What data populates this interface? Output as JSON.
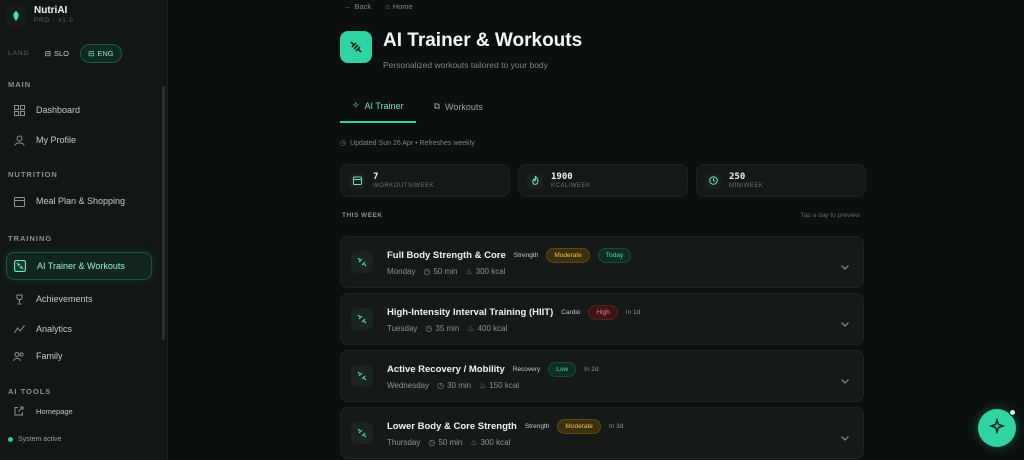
{
  "brand": {
    "name": "NutriAI",
    "sub": "PRO · v1.0"
  },
  "lang": {
    "label": "LANG",
    "options": [
      "SLO",
      "ENG"
    ],
    "selected": "ENG"
  },
  "sidebar": {
    "sections": {
      "main": "MAIN",
      "nutrition": "NUTRITION",
      "training": "TRAINING",
      "ai_tools": "AI TOOLS"
    },
    "items": {
      "dashboard": "Dashboard",
      "profile": "My Profile",
      "meal_plan": "Meal Plan & Shopping",
      "ai_trainer": "AI Trainer & Workouts",
      "achievements": "Achievements",
      "analytics": "Analytics",
      "family": "Family",
      "homepage": "Homepage"
    },
    "active_item": "ai_trainer",
    "status": "System active"
  },
  "breadcrumb": {
    "back": "Back",
    "home": "Home"
  },
  "header": {
    "title": "AI Trainer & Workouts",
    "subtitle": "Personalized workouts tailored to your body"
  },
  "tabs": [
    {
      "label": "AI Trainer",
      "active": true
    },
    {
      "label": "Workouts",
      "active": false
    }
  ],
  "updated": "Updated Sun 26 Apr • Refreshes weekly",
  "stats": [
    {
      "value": "7",
      "label": "WORKOUTS/WEEK",
      "icon": "calendar-icon"
    },
    {
      "value": "1900",
      "label": "KCAL/WEEK",
      "icon": "flame-icon"
    },
    {
      "value": "250",
      "label": "MIN/WEEK",
      "icon": "clock-icon"
    }
  ],
  "week": {
    "title": "THIS WEEK",
    "hint": "Tap a day to preview"
  },
  "workouts": [
    {
      "name": "Full Body Strength & Core",
      "type": "Strength",
      "intensity": "Moderate",
      "due": "Today",
      "day": "Monday",
      "duration": "50 min",
      "kcal": "300 kcal"
    },
    {
      "name": "High-Intensity Interval Training (HIIT)",
      "type": "Cardio",
      "intensity": "High",
      "due": "In 1d",
      "day": "Tuesday",
      "duration": "35 min",
      "kcal": "400 kcal"
    },
    {
      "name": "Active Recovery / Mobility",
      "type": "Recovery",
      "intensity": "Low",
      "due": "In 2d",
      "day": "Wednesday",
      "duration": "30 min",
      "kcal": "150 kcal"
    },
    {
      "name": "Lower Body & Core Strength",
      "type": "Strength",
      "intensity": "Moderate",
      "due": "In 3d",
      "day": "Thursday",
      "duration": "50 min",
      "kcal": "300 kcal"
    }
  ],
  "colors": {
    "accent": "#2fd4a2",
    "background": "#0c0f0f",
    "moderate": "#f0c24a",
    "high": "#f07a7a",
    "low": "#58d8a6"
  }
}
